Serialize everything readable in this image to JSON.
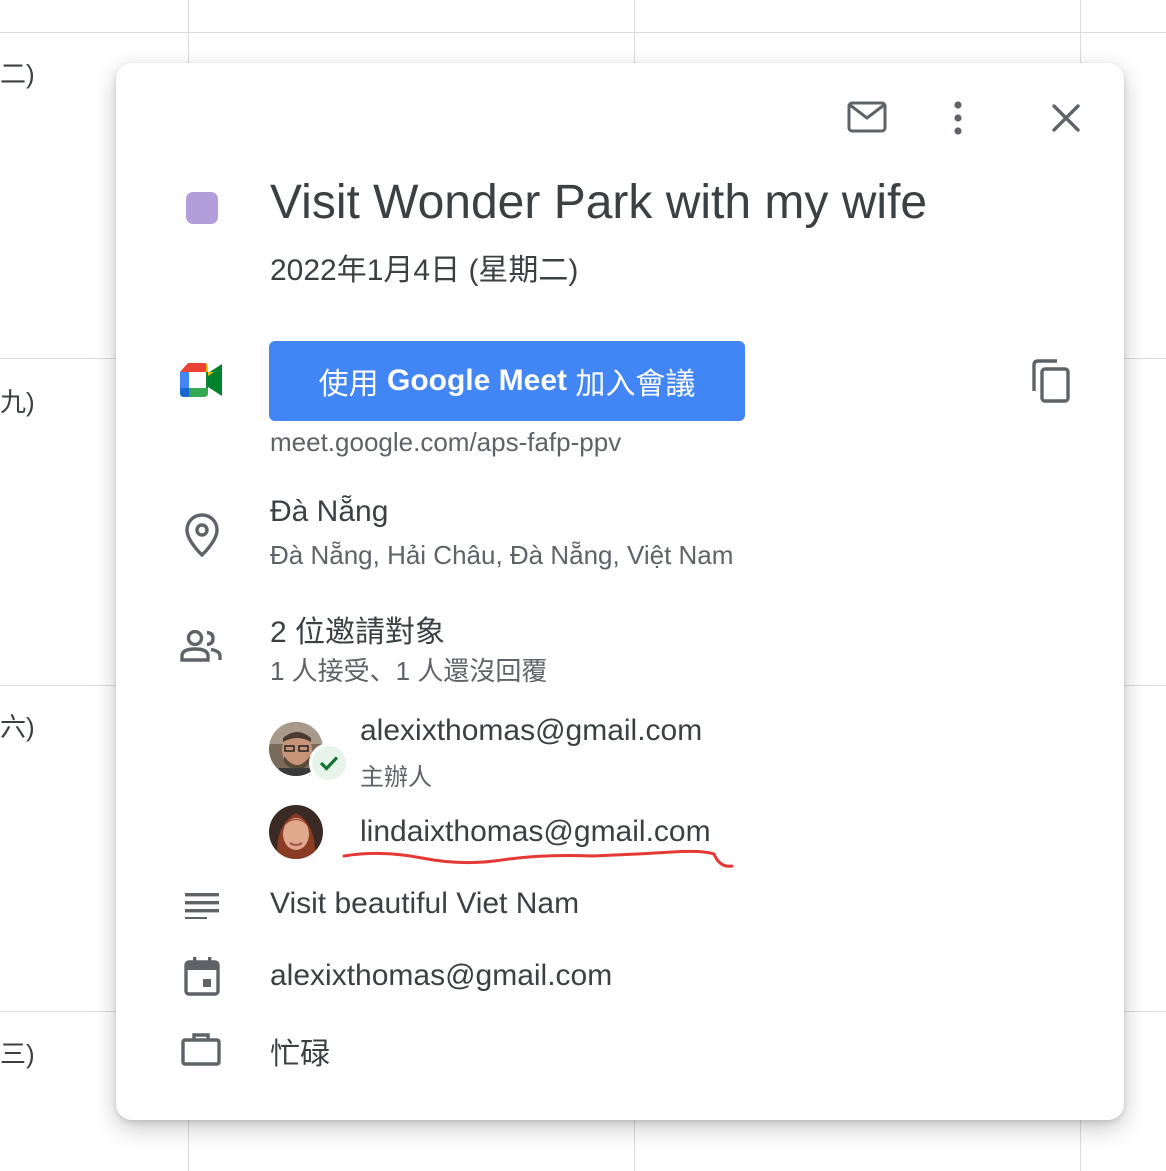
{
  "background": {
    "day_labels": [
      "二)",
      "九)",
      "六)",
      "三)"
    ],
    "colors": {
      "grid": "#dadce0"
    }
  },
  "toolbar": {
    "email_icon": "email-icon",
    "more_icon": "more-vert-icon",
    "close_icon": "close-icon"
  },
  "event": {
    "color": "#b39ddb",
    "title": "Visit Wonder Park with my wife",
    "date": "2022年1月4日 (星期二)"
  },
  "meet": {
    "button_prefix": "使用 ",
    "button_brand": "Google Meet",
    "button_suffix": " 加入會議",
    "url": "meet.google.com/aps-fafp-ppv",
    "button_color": "#4285f4",
    "copy_icon": "copy-icon"
  },
  "location": {
    "name": "Đà Nẵng",
    "address": "Đà Nẵng, Hải Châu, Đà Nẵng, Việt Nam"
  },
  "guests": {
    "summary": "2 位邀請對象",
    "status": "1 人接受、1 人還沒回覆",
    "list": [
      {
        "email": "alexixthomas@gmail.com",
        "role": "主辦人",
        "accepted": true
      },
      {
        "email": "lindaixthomas@gmail.com"
      }
    ],
    "annotation_color": "#e53935"
  },
  "description": "Visit beautiful Viet Nam",
  "calendar_owner": "alexixthomas@gmail.com",
  "availability": "忙碌"
}
